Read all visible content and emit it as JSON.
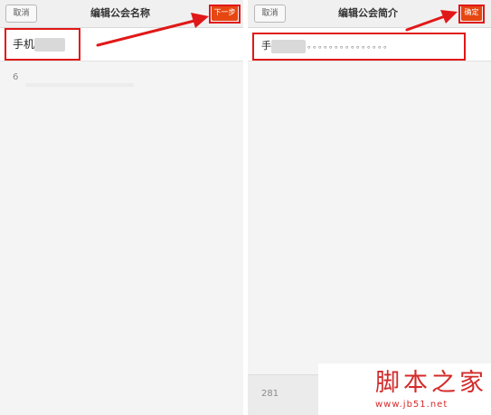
{
  "left_screen": {
    "cancel_label": "取消",
    "title": "编辑公会名称",
    "next_label": "下一步",
    "name_prefix": "手机",
    "char_counter": "6"
  },
  "right_screen": {
    "cancel_label": "取消",
    "title": "编辑公会简介",
    "confirm_label": "确定",
    "intro_prefix": "手",
    "intro_dots": "。。。。。。。。。。。。。。。",
    "char_counter": "281"
  },
  "watermark": {
    "main": "脚本之家",
    "sub": "www.jb51.net"
  },
  "colors": {
    "accent": "#e64712",
    "highlight": "#e11818",
    "watermark": "#d42a2a"
  }
}
